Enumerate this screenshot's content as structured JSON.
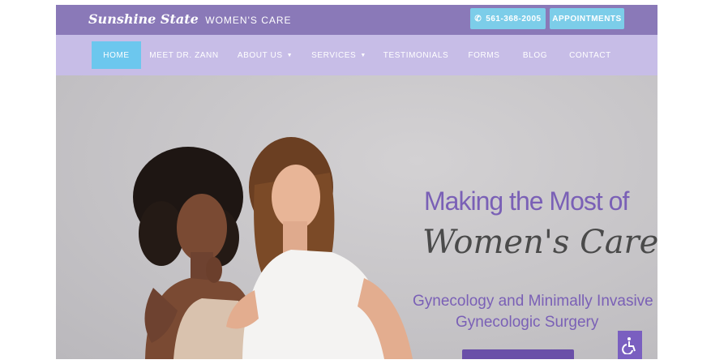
{
  "header": {
    "logo_script": "Sunshine State",
    "logo_caps": "WOMEN'S CARE",
    "phone_label": "561-368-2005",
    "appointments_label": "APPOINTMENTS"
  },
  "nav": {
    "items": [
      {
        "label": "HOME"
      },
      {
        "label": "MEET DR. ZANN"
      },
      {
        "label": "ABOUT US"
      },
      {
        "label": "SERVICES"
      },
      {
        "label": "TESTIMONIALS"
      },
      {
        "label": "FORMS"
      },
      {
        "label": "BLOG"
      },
      {
        "label": "CONTACT"
      }
    ]
  },
  "hero": {
    "heading_line1": "Making the Most of",
    "heading_line2": "Women's Care",
    "subheading_line1": "Gynecology and Minimally Invasive",
    "subheading_line2": "Gynecologic Surgery"
  },
  "icons": {
    "phone": "phone-icon",
    "caret": "caret-down-icon",
    "accessibility": "wheelchair-icon"
  },
  "colors": {
    "brand_purple": "#8a79b8",
    "nav_lavender": "#c7bde7",
    "accent_blue": "#7ccde9",
    "heading_purple": "#7a60b6"
  }
}
